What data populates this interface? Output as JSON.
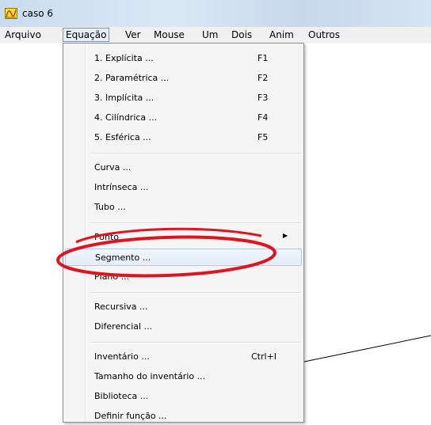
{
  "window": {
    "title": "caso 6",
    "icon": "app-graph-icon"
  },
  "menubar": {
    "items": [
      "Arquivo",
      "Equação",
      "Ver",
      "Mouse",
      "Um",
      "Dois",
      "Anim",
      "Outros"
    ],
    "active": "Equação"
  },
  "dropdown": {
    "items": [
      {
        "label": "1. Explícita ...",
        "shortcut": "F1"
      },
      {
        "label": "2. Paramétrica ...",
        "shortcut": "F2"
      },
      {
        "label": "3. Implícita ...",
        "shortcut": "F3"
      },
      {
        "label": "4. Cilíndrica ...",
        "shortcut": "F4"
      },
      {
        "label": "5. Esférica ...",
        "shortcut": "F5"
      },
      {
        "label": "Curva ..."
      },
      {
        "label": "Intrínseca ..."
      },
      {
        "label": "Tubo ..."
      },
      {
        "label": "Ponto",
        "submenu": "submenu-arrow-icon"
      },
      {
        "label": "Segmento ...",
        "highlighted": true
      },
      {
        "label": "Plano ..."
      },
      {
        "label": "Recursiva ..."
      },
      {
        "label": "Diferencial ..."
      },
      {
        "label": "Inventário ...",
        "shortcut": "Ctrl+I"
      },
      {
        "label": "Tamanho do inventário ..."
      },
      {
        "label": "Biblioteca ..."
      },
      {
        "label": "Definir função ..."
      }
    ]
  },
  "annotation": {
    "shape": "ellipse",
    "color": "#e0141e",
    "encloses": "Segmento ..."
  }
}
